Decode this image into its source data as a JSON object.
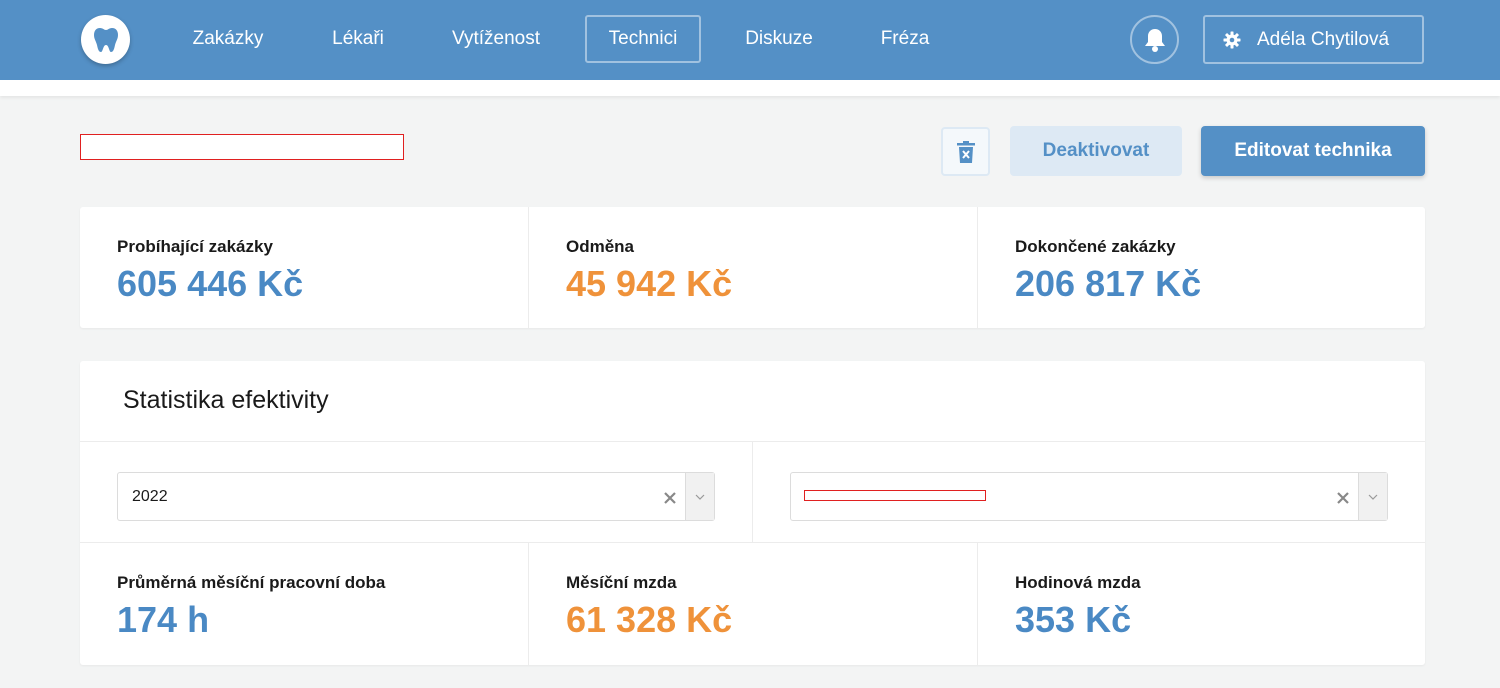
{
  "nav": {
    "items": [
      {
        "label": "Zakázky"
      },
      {
        "label": "Lékaři"
      },
      {
        "label": "Vytíženost"
      },
      {
        "label": "Technici"
      },
      {
        "label": "Diskuze"
      },
      {
        "label": "Fréza"
      }
    ],
    "active": "Technici",
    "user_name": "Adéla Chytilová"
  },
  "header": {
    "deactivate_label": "Deaktivovat",
    "edit_label": "Editovat technika"
  },
  "stats": [
    {
      "label": "Probíhající zakázky",
      "value": "605 446 Kč",
      "color": "#4a89c4"
    },
    {
      "label": "Odměna",
      "value": "45 942 Kč",
      "color": "#ef923a"
    },
    {
      "label": "Dokončené zakázky",
      "value": "206 817 Kč",
      "color": "#4a89c4"
    }
  ],
  "efficiency": {
    "title": "Statistika efektivity",
    "year_select": {
      "value": "2022"
    },
    "metrics": [
      {
        "label": "Průměrná měsíční pracovní doba",
        "value": "174 h",
        "color": "#4a89c4"
      },
      {
        "label": "Měsíční mzda",
        "value": "61 328 Kč",
        "color": "#ef923a"
      },
      {
        "label": "Hodinová mzda",
        "value": "353 Kč",
        "color": "#4a89c4"
      }
    ]
  },
  "colors": {
    "primary": "#5490c6",
    "accent_orange": "#ef923a",
    "button_light": "#dde9f4"
  }
}
